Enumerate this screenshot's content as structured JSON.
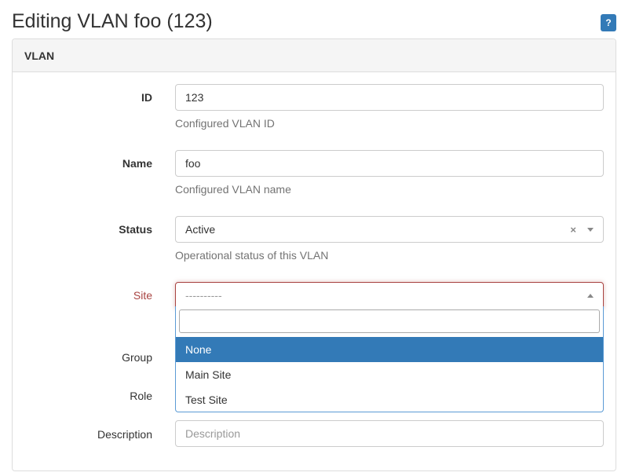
{
  "header": {
    "title": "Editing VLAN foo (123)",
    "help_label": "?"
  },
  "panel": {
    "heading": "VLAN"
  },
  "fields": {
    "id": {
      "label": "ID",
      "value": "123",
      "help": "Configured VLAN ID"
    },
    "name": {
      "label": "Name",
      "value": "foo",
      "help": "Configured VLAN name"
    },
    "status": {
      "label": "Status",
      "value": "Active",
      "clear": "×",
      "help": "Operational status of this VLAN"
    },
    "site": {
      "label": "Site",
      "value": "----------"
    },
    "group": {
      "label": "Group"
    },
    "role": {
      "label": "Role"
    },
    "description": {
      "label": "Description",
      "placeholder": "Description"
    }
  },
  "site_dropdown": {
    "search_value": "",
    "options": [
      "None",
      "Main Site",
      "Test Site"
    ],
    "highlighted": "None"
  },
  "colors": {
    "primary": "#337ab7",
    "error": "#a94442",
    "panel_heading_bg": "#f5f5f5"
  }
}
